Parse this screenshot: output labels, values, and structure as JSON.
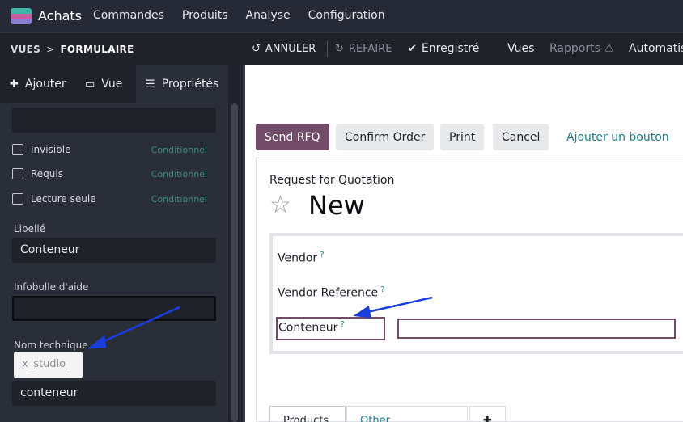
{
  "topnav": {
    "app_name": "Achats",
    "menu": [
      "Commandes",
      "Produits",
      "Analyse",
      "Configuration"
    ]
  },
  "studiobar": {
    "crumb_root": "VUES",
    "crumb_sep": ">",
    "crumb_current": "FORMULAIRE",
    "undo": "ANNULER",
    "redo": "REFAIRE",
    "saved": "Enregistré",
    "views": "Vues",
    "reports": "Rapports",
    "automations": "Automatis"
  },
  "sidebar": {
    "tabs": {
      "add": "Ajouter",
      "view": "Vue",
      "properties": "Propriétés"
    },
    "checks": [
      {
        "label": "Invisible",
        "cond": "Conditionnel"
      },
      {
        "label": "Requis",
        "cond": "Conditionnel"
      },
      {
        "label": "Lecture seule",
        "cond": "Conditionnel"
      }
    ],
    "label_title": "Libellé",
    "label_value": "Conteneur",
    "tooltip_title": "Infobulle d'aide",
    "tooltip_value": "",
    "tech_title": "Nom technique",
    "tech_prefix": "x_studio_",
    "tech_value": "conteneur"
  },
  "form": {
    "buttons": {
      "send": "Send RFQ",
      "confirm": "Confirm Order",
      "print": "Print",
      "cancel": "Cancel",
      "add_button": "Ajouter un bouton"
    },
    "doc_type": "Request for Quotation",
    "title": "New",
    "fields": {
      "vendor": "Vendor",
      "vendor_ref": "Vendor Reference",
      "container": "Conteneur",
      "help": "?"
    },
    "tabs": [
      "Products",
      "Other Information"
    ]
  },
  "colors": {
    "primary": "#714b67",
    "link": "#1f7b86",
    "arrow": "#1a3de0"
  }
}
